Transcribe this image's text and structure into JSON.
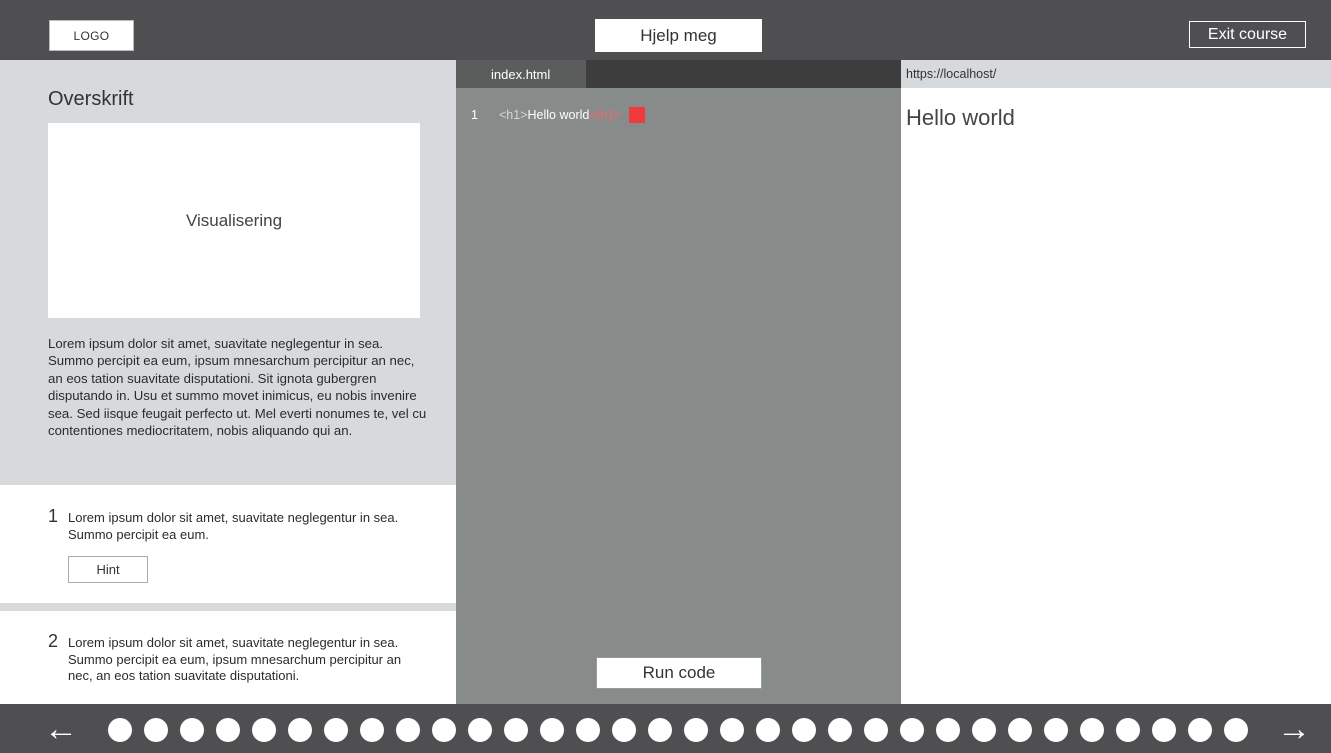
{
  "header": {
    "logo": "LOGO",
    "help_label": "Hjelp meg",
    "exit_label": "Exit course"
  },
  "lesson": {
    "heading": "Overskrift",
    "visual_label": "Visualisering",
    "body": "Lorem ipsum dolor sit amet, suavitate neglegentur in sea. Summo percipit ea eum, ipsum mnesarchum percipitur an nec, an eos tation suavitate disputationi. Sit ignota gubergren disputando in. Usu et summo movet inimicus, eu nobis invenire sea. Sed iisque feugait perfecto ut. Mel everti nonumes te, vel cu contentiones mediocritatem, nobis aliquando qui an."
  },
  "tasks": [
    {
      "number": "1",
      "text": "Lorem ipsum dolor sit amet, suavitate neglegentur in sea. Summo percipit ea eum.",
      "hint_label": "Hint"
    },
    {
      "number": "2",
      "text": "Lorem ipsum dolor sit amet, suavitate neglegentur in sea. Summo percipit ea eum, ipsum mnesarchum percipitur an nec, an eos tation suavitate disputationi."
    }
  ],
  "editor": {
    "tab_label": "index.html",
    "line_number": "1",
    "code_open_tag": "<h1>",
    "code_text": "Hello world",
    "code_error": "</h1>",
    "error_color": "#ef3b3b",
    "run_label": "Run code"
  },
  "preview": {
    "url": "https://localhost/",
    "heading": "Hello world"
  },
  "navigation": {
    "prev_icon": "arrow-left-icon",
    "next_icon": "arrow-right-icon",
    "prev_glyph": "←",
    "next_glyph": "→",
    "step_count": 32
  }
}
